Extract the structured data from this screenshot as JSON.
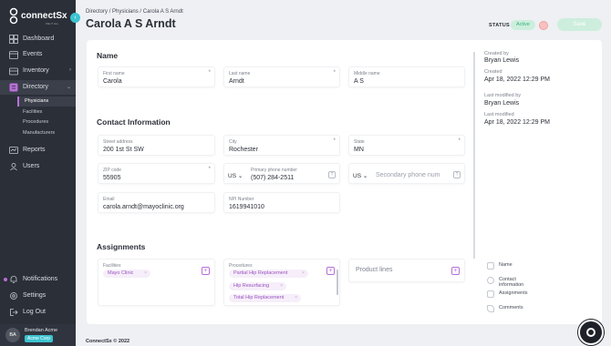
{
  "app": {
    "logo_text": "connectSx",
    "logo_sub": "WE IT ALL"
  },
  "sidebar": {
    "items": [
      {
        "label": "Dashboard",
        "icon": "dashboard-icon"
      },
      {
        "label": "Events",
        "icon": "calendar-icon"
      },
      {
        "label": "Inventory",
        "icon": "inventory-icon"
      },
      {
        "label": "Directory",
        "icon": "directory-icon"
      },
      {
        "label": "Reports",
        "icon": "reports-icon"
      },
      {
        "label": "Users",
        "icon": "users-icon"
      }
    ],
    "directory_sub": [
      "Physicians",
      "Facilities",
      "Procedures",
      "Manufacturers"
    ],
    "bottom_items": [
      {
        "label": "Notifications",
        "icon": "bell-icon"
      },
      {
        "label": "Settings",
        "icon": "gear-icon"
      },
      {
        "label": "Log Out",
        "icon": "logout-icon"
      }
    ],
    "user": {
      "initials": "BA",
      "name": "Brendan Acme",
      "org": "Acme Corp"
    }
  },
  "breadcrumb": {
    "root": "Directory",
    "section": "Physicians",
    "current": "Carola A S Arndt",
    "sep": "/"
  },
  "page": {
    "title": "Carola A S Arndt"
  },
  "status": {
    "label": "STATUS",
    "value": "Active",
    "save_label": "Save"
  },
  "sections": {
    "name": "Name",
    "contact": "Contact Information",
    "assignments": "Assignments"
  },
  "fields": {
    "first_name": {
      "label": "First name",
      "value": "Carola",
      "required": "*"
    },
    "last_name": {
      "label": "Last name",
      "value": "Arndt",
      "required": "*"
    },
    "middle_name": {
      "label": "Middle name",
      "value": "A S"
    },
    "street": {
      "label": "Street address",
      "value": "200 1st St SW"
    },
    "city": {
      "label": "City",
      "value": "Rochester",
      "required": "*"
    },
    "state": {
      "label": "State",
      "value": "MN",
      "required": "*"
    },
    "zip": {
      "label": "ZIP code",
      "value": "55905",
      "required": "*"
    },
    "primary_phone": {
      "country": "US",
      "label": "Primary phone number",
      "value": "(507) 284-2511",
      "help": "?"
    },
    "secondary_phone": {
      "country": "US",
      "placeholder": "Secondary phone num",
      "help": "?"
    },
    "email": {
      "label": "Email",
      "value": "carola.arndt@mayoclinic.org"
    },
    "npi": {
      "label": "NPI Number",
      "value": "1619941010"
    }
  },
  "assignments": {
    "facilities": {
      "label": "Facilities",
      "chips": [
        "Mayo Clinic"
      ]
    },
    "procedures": {
      "label": "Procedures",
      "chips": [
        "Partial Hip Replacement",
        "Hip Resurfacing",
        "Total Hip Replacement"
      ]
    },
    "product_lines": {
      "placeholder": "Product lines"
    },
    "add_symbol": "+",
    "remove_symbol": "×"
  },
  "meta": {
    "created_by_label": "Created by",
    "created_by": "Bryan Lewis",
    "created_label": "Created",
    "created": "Apr 18, 2022 12:29 PM",
    "modified_by_label": "Last modified by",
    "modified_by": "Bryan Lewis",
    "modified_label": "Last modified",
    "modified": "Apr 18, 2022 12:29 PM"
  },
  "toc": [
    {
      "label": "Name",
      "icon": "name-icon"
    },
    {
      "label": "Contact information",
      "icon": "contact-icon"
    },
    {
      "label": "Assignments",
      "icon": "assignments-icon"
    },
    {
      "label": "Comments",
      "icon": "comments-icon"
    }
  ],
  "footer": {
    "text": "ConnectSx © 2022"
  },
  "colors": {
    "sidebar": "#2b2f38",
    "accent": "#b86fd8",
    "teal": "#3cc3d0",
    "active_green": "#37b07a"
  }
}
